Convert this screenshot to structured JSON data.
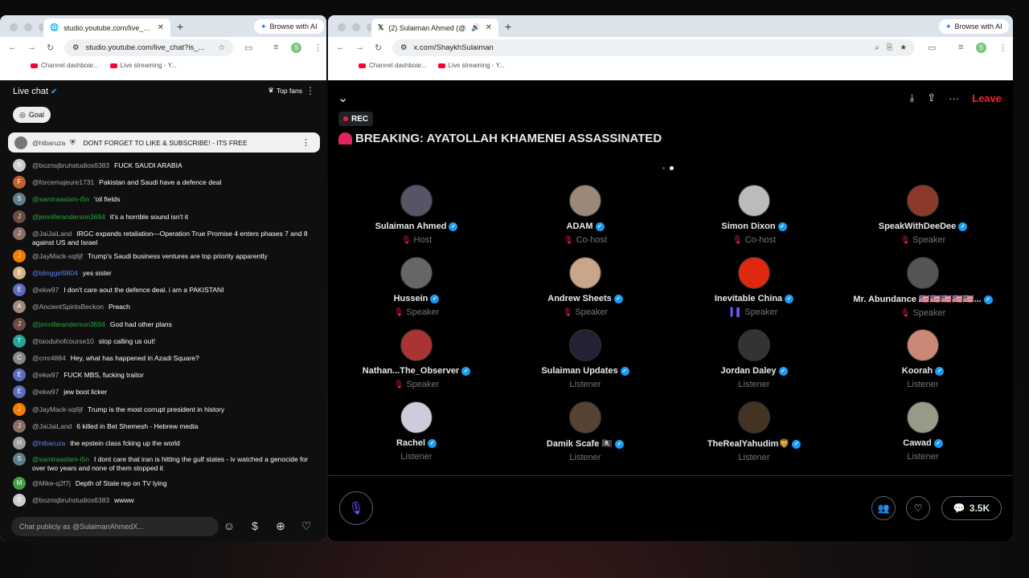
{
  "youtube_window": {
    "tab_title": "studio.youtube.com/live_chat?is_...",
    "ai_button": "Browse with AI",
    "url": "studio.youtube.com/live_chat?is_...",
    "bookmarks": [
      "Channel dashboar...",
      "Live streaming - Y..."
    ],
    "profile_initial": "S",
    "chat": {
      "title": "Live chat",
      "top_fans": "Top fans",
      "goal": "Goal",
      "pinned": {
        "user": "@hibaruza",
        "text": "DONT FORGET TO LIKE & SUBSCRIBE! - ITS FREE"
      },
      "messages": [
        {
          "user": "@boznsjbruhstudios6383",
          "text": "FUCK SAUDI ARABIA",
          "color": "#ccc"
        },
        {
          "user": "@forcemajeure1731",
          "text": "Pakistan and Saudi have a defence deal",
          "color": "#c0612b"
        },
        {
          "user": "@samiraaslam-i5n",
          "text": "'oil fields",
          "color": "#607d8b",
          "green": true
        },
        {
          "user": "@jenniferanderson3694",
          "text": "it's a horrible sound isn't it",
          "color": "#6d4c41",
          "green": true
        },
        {
          "user": "@JaiJaiLand",
          "text": "IRGC expands retaliation—Operation True Promise 4 enters phases 7 and 8 against US and Israel",
          "color": "#8d6e63"
        },
        {
          "user": "@JayMack-sq6jf",
          "text": "Trump's Saudi business ventures are top priority apparently",
          "color": "#f57c00"
        },
        {
          "user": "@blinggirl9804",
          "text": "yes sister",
          "color": "#d4b483",
          "blue": true
        },
        {
          "user": "@ekw97",
          "text": "I don't care aout the defence deal. i am a PAKISTANI",
          "color": "#5c6bc0"
        },
        {
          "user": "@AncientSpiritsBeckon",
          "text": "Preach",
          "color": "#a1887f"
        },
        {
          "user": "@jenniferanderson3694",
          "text": "God had other plans",
          "color": "#6d4c41",
          "green": true
        },
        {
          "user": "@taoduhofcourse10",
          "text": "stop calling us out!",
          "color": "#26a69a"
        },
        {
          "user": "@cmr4884",
          "text": "Hey, what has happened in Azadi Square?",
          "color": "#888"
        },
        {
          "user": "@ekw97",
          "text": "FUCK MBS, fucking traitor",
          "color": "#5c6bc0"
        },
        {
          "user": "@ekw97",
          "text": "jew boot licker",
          "color": "#5c6bc0"
        },
        {
          "user": "@JayMack-sq6jf",
          "text": "Trump is the most corrupt president in history",
          "color": "#f57c00"
        },
        {
          "user": "@JaiJaiLand",
          "text": "6 killed in Bet Shemesh - Hebrew media",
          "color": "#8d6e63"
        },
        {
          "user": "@hibaruza",
          "text": "the epstein class fcking up the world",
          "color": "#9e9e9e",
          "blue": true
        },
        {
          "user": "@samiraaslam-i5n",
          "text": "I dont care that iran is hitting the gulf states - iv watched a genocide for over two years and none of them stopped it",
          "color": "#607d8b",
          "green": true
        },
        {
          "user": "@Mike-q2f7j",
          "text": "Depth of State rep on TV lying",
          "color": "#43a047"
        },
        {
          "user": "@boznsjbruhstudios6383",
          "text": "wwww",
          "color": "#ccc"
        }
      ],
      "placeholder": "Chat publicly as @SulaimanAhmedX..."
    }
  },
  "x_window": {
    "tab_title": "(2) Sulaiman Ahmed (@S...",
    "ai_button": "Browse with AI",
    "url": "x.com/ShaykhSulaiman",
    "bookmarks": [
      "Channel dashboar...",
      "Live streaming - Y..."
    ],
    "profile_initial": "S",
    "space": {
      "leave": "Leave",
      "rec": "REC",
      "title": "BREAKING: AYATOLLAH KHAMENEI ASSASSINATED",
      "participants": [
        {
          "name": "Sulaiman Ahmed",
          "role": "Host",
          "icon": "mic-off",
          "color": "#556"
        },
        {
          "name": "ADAM",
          "role": "Co-host",
          "icon": "mic-off",
          "color": "#9a8878"
        },
        {
          "name": "Simon Dixon",
          "role": "Co-host",
          "icon": "mic-off",
          "color": "#bbb"
        },
        {
          "name": "SpeakWithDeeDee",
          "role": "Speaker",
          "icon": "mic-off",
          "color": "#8b3a2a"
        },
        {
          "name": "Hussein",
          "role": "Speaker",
          "icon": "mic-off",
          "color": "#666"
        },
        {
          "name": "Andrew Sheets",
          "role": "Speaker",
          "icon": "mic-off",
          "color": "#c9a58a"
        },
        {
          "name": "Inevitable China",
          "role": "Speaker",
          "icon": "eq",
          "color": "#de2910"
        },
        {
          "name": "Mr. Abundance 🇺🇸🇺🇸🇺🇸🇺🇸🇺🇸...",
          "role": "Speaker",
          "icon": "mic-off",
          "color": "#555"
        },
        {
          "name": "Nathan...The_Observer",
          "role": "Speaker",
          "icon": "mic-off",
          "color": "#a33"
        },
        {
          "name": "Sulaiman Updates",
          "role": "Listener",
          "icon": "",
          "color": "#223"
        },
        {
          "name": "Jordan Daley",
          "role": "Listener",
          "icon": "",
          "color": "#333"
        },
        {
          "name": "Koorah",
          "role": "Listener",
          "icon": "",
          "color": "#c87"
        },
        {
          "name": "Rachel",
          "role": "Listener",
          "icon": "",
          "color": "#ccd"
        },
        {
          "name": "Damik Scafe 🏴‍☠️",
          "role": "Listener",
          "icon": "",
          "color": "#543"
        },
        {
          "name": "TheRealYahudim🦁",
          "role": "Listener",
          "icon": "",
          "color": "#432"
        },
        {
          "name": "Cawad",
          "role": "Listener",
          "icon": "",
          "color": "#998"
        }
      ],
      "comments_count": "3.5K"
    }
  }
}
